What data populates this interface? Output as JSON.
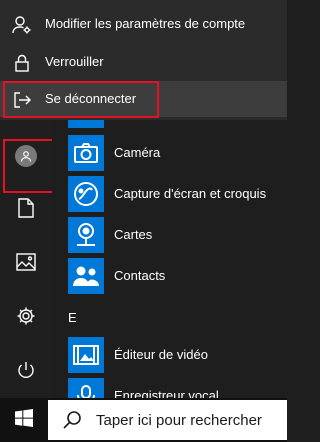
{
  "account_menu": {
    "items": [
      {
        "label": "Modifier les paramètres de compte",
        "icon": "person-settings-icon"
      },
      {
        "label": "Verrouiller",
        "icon": "lock-icon"
      },
      {
        "label": "Se déconnecter",
        "icon": "sign-out-icon",
        "highlighted": true
      }
    ]
  },
  "rail": {
    "items": [
      {
        "icon": "avatar-icon",
        "highlighted": true
      },
      {
        "icon": "document-icon"
      },
      {
        "icon": "pictures-icon"
      },
      {
        "icon": "settings-gear-icon"
      },
      {
        "icon": "power-icon"
      }
    ]
  },
  "app_list": {
    "apps": [
      {
        "label": "Caméra",
        "icon": "camera-icon"
      },
      {
        "label": "Capture d'écran et croquis",
        "icon": "snip-sketch-icon"
      },
      {
        "label": "Cartes",
        "icon": "maps-icon"
      },
      {
        "label": "Contacts",
        "icon": "people-icon"
      },
      {
        "label": "Éditeur de vidéo",
        "icon": "video-editor-icon"
      },
      {
        "label": "Enregistreur vocal",
        "icon": "voice-recorder-icon"
      }
    ],
    "section_e": "E"
  },
  "taskbar": {
    "start_icon": "windows-logo-icon",
    "search_placeholder": "Taper ici pour rechercher"
  },
  "colors": {
    "accent": "#0078d7",
    "highlight_border": "#e81123"
  }
}
